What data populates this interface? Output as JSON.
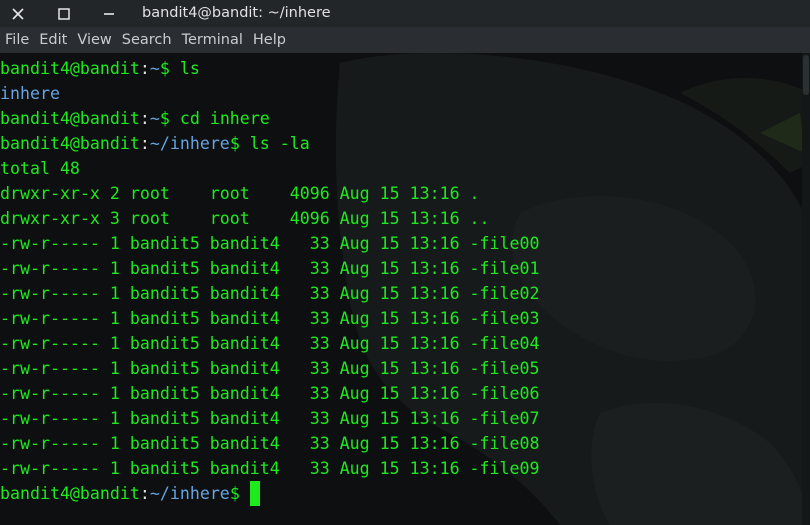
{
  "window": {
    "title": "bandit4@bandit: ~/inhere",
    "controls": [
      "close-icon",
      "maximize-icon",
      "minimize-icon"
    ]
  },
  "menu": [
    "File",
    "Edit",
    "View",
    "Search",
    "Terminal",
    "Help"
  ],
  "colors": {
    "prompt_user": "#1eea1e",
    "path": "#66a3e0",
    "output": "#1eea1e",
    "cursor": "#1eea1e"
  },
  "terminal": {
    "lines": [
      {
        "user": "bandit4@bandit",
        "sep": ":",
        "path": "~",
        "tail": "$ ls"
      },
      {
        "dir_out": "inhere"
      },
      {
        "user": "bandit4@bandit",
        "sep": ":",
        "path": "~",
        "tail": "$ cd inhere"
      },
      {
        "user": "bandit4@bandit",
        "sep": ":",
        "path": "~/inhere",
        "tail": "$ ls -la"
      },
      {
        "out": "total 48"
      },
      {
        "out": "drwxr-xr-x 2 root    root    4096 Aug 15 13:16 ."
      },
      {
        "out": "drwxr-xr-x 3 root    root    4096 Aug 15 13:16 .."
      },
      {
        "out": "-rw-r----- 1 bandit5 bandit4   33 Aug 15 13:16 -file00"
      },
      {
        "out": "-rw-r----- 1 bandit5 bandit4   33 Aug 15 13:16 -file01"
      },
      {
        "out": "-rw-r----- 1 bandit5 bandit4   33 Aug 15 13:16 -file02"
      },
      {
        "out": "-rw-r----- 1 bandit5 bandit4   33 Aug 15 13:16 -file03"
      },
      {
        "out": "-rw-r----- 1 bandit5 bandit4   33 Aug 15 13:16 -file04"
      },
      {
        "out": "-rw-r----- 1 bandit5 bandit4   33 Aug 15 13:16 -file05"
      },
      {
        "out": "-rw-r----- 1 bandit5 bandit4   33 Aug 15 13:16 -file06"
      },
      {
        "out": "-rw-r----- 1 bandit5 bandit4   33 Aug 15 13:16 -file07"
      },
      {
        "out": "-rw-r----- 1 bandit5 bandit4   33 Aug 15 13:16 -file08"
      },
      {
        "out": "-rw-r----- 1 bandit5 bandit4   33 Aug 15 13:16 -file09"
      },
      {
        "user": "bandit4@bandit",
        "sep": ":",
        "path": "~/inhere",
        "tail": "$ ",
        "cursor": true
      }
    ]
  }
}
